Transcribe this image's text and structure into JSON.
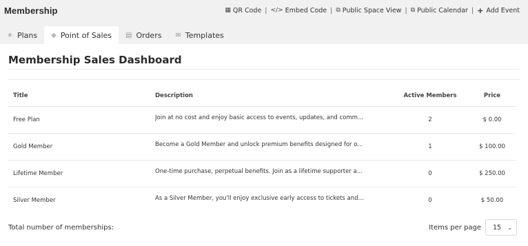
{
  "header": {
    "title": "Membership",
    "actions": {
      "qr_code": "QR Code",
      "embed_code": "Embed Code",
      "public_space_view": "Public Space View",
      "public_calendar": "Public Calendar",
      "add_event": "Add Event"
    },
    "separator": "|"
  },
  "tabs": [
    {
      "label": "Plans",
      "icon": "star-icon",
      "active": false
    },
    {
      "label": "Point of Sales",
      "icon": "diamond-icon",
      "active": true
    },
    {
      "label": "Orders",
      "icon": "document-icon",
      "active": false
    },
    {
      "label": "Templates",
      "icon": "envelope-icon",
      "active": false
    }
  ],
  "panel": {
    "title": "Membership Sales Dashboard"
  },
  "table": {
    "columns": {
      "title": "Title",
      "description": "Description",
      "active_members": "Active Members",
      "price": "Price"
    },
    "rows": [
      {
        "title": "Free Plan",
        "description": "Join at no cost and enjoy basic access to events, updates, and comm...",
        "active_members": "2",
        "price": "$ 0.00"
      },
      {
        "title": "Gold Member",
        "description": "Become a Gold Member and unlock premium benefits designed for o...",
        "active_members": "1",
        "price": "$ 100.00"
      },
      {
        "title": "Lifetime Member",
        "description": "One-time purchase, perpetual benefits. Join as a lifetime supporter a...",
        "active_members": "0",
        "price": "$ 250.00"
      },
      {
        "title": "Silver Member",
        "description": "As a Silver Member, you'll enjoy exclusive early access to tickets and d...",
        "active_members": "0",
        "price": "$ 50.00"
      }
    ]
  },
  "footer": {
    "total_label": "Total number of memberships:",
    "items_per_page_label": "Items per page",
    "items_per_page_value": "15"
  }
}
